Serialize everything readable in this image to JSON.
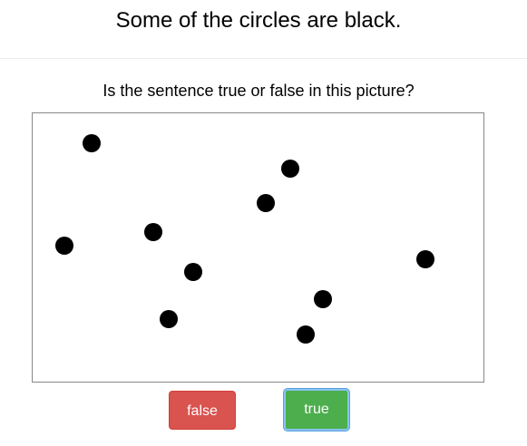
{
  "sentence": "Some of the circles are black.",
  "question": "Is the sentence true or false in this picture?",
  "buttons": {
    "false_label": "false",
    "true_label": "true"
  },
  "circles": [
    {
      "color": "black"
    },
    {
      "color": "black"
    },
    {
      "color": "black"
    },
    {
      "color": "black"
    },
    {
      "color": "black"
    },
    {
      "color": "black"
    },
    {
      "color": "black"
    },
    {
      "color": "black"
    },
    {
      "color": "black"
    },
    {
      "color": "black"
    },
    {
      "color": "white"
    }
  ],
  "colors": {
    "false_button": "#d9534f",
    "true_button": "#4cae4c",
    "focus_ring": "#8ac4f0"
  }
}
